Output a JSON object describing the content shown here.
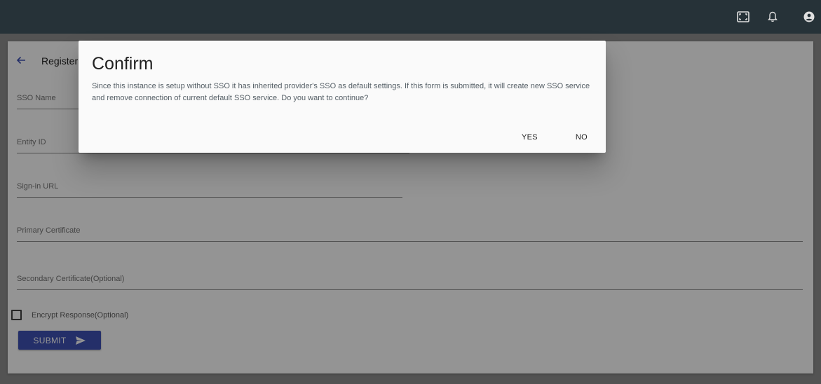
{
  "topbar": {
    "icons": [
      "fullscreen-icon",
      "bell-icon",
      "account-icon"
    ],
    "background": "#263238"
  },
  "page": {
    "title": "Register",
    "fields": [
      {
        "label": "SSO Name"
      },
      {
        "label": "Entity ID"
      },
      {
        "label": "Sign-in URL"
      },
      {
        "label": "Primary Certificate"
      },
      {
        "label": "Secondary Certificate(Optional)"
      }
    ],
    "checkbox_label": "Encrypt Response(Optional)",
    "submit_label": "SUBMIT",
    "accent": "#3f51b5"
  },
  "dialog": {
    "title": "Confirm",
    "message": "Since this instance is setup without SSO it has inherited provider's SSO as default settings. If this form is submitted, it will create new SSO service and remove connection of current default SSO service. Do you want to continue?",
    "yes_label": "YES",
    "no_label": "NO"
  }
}
